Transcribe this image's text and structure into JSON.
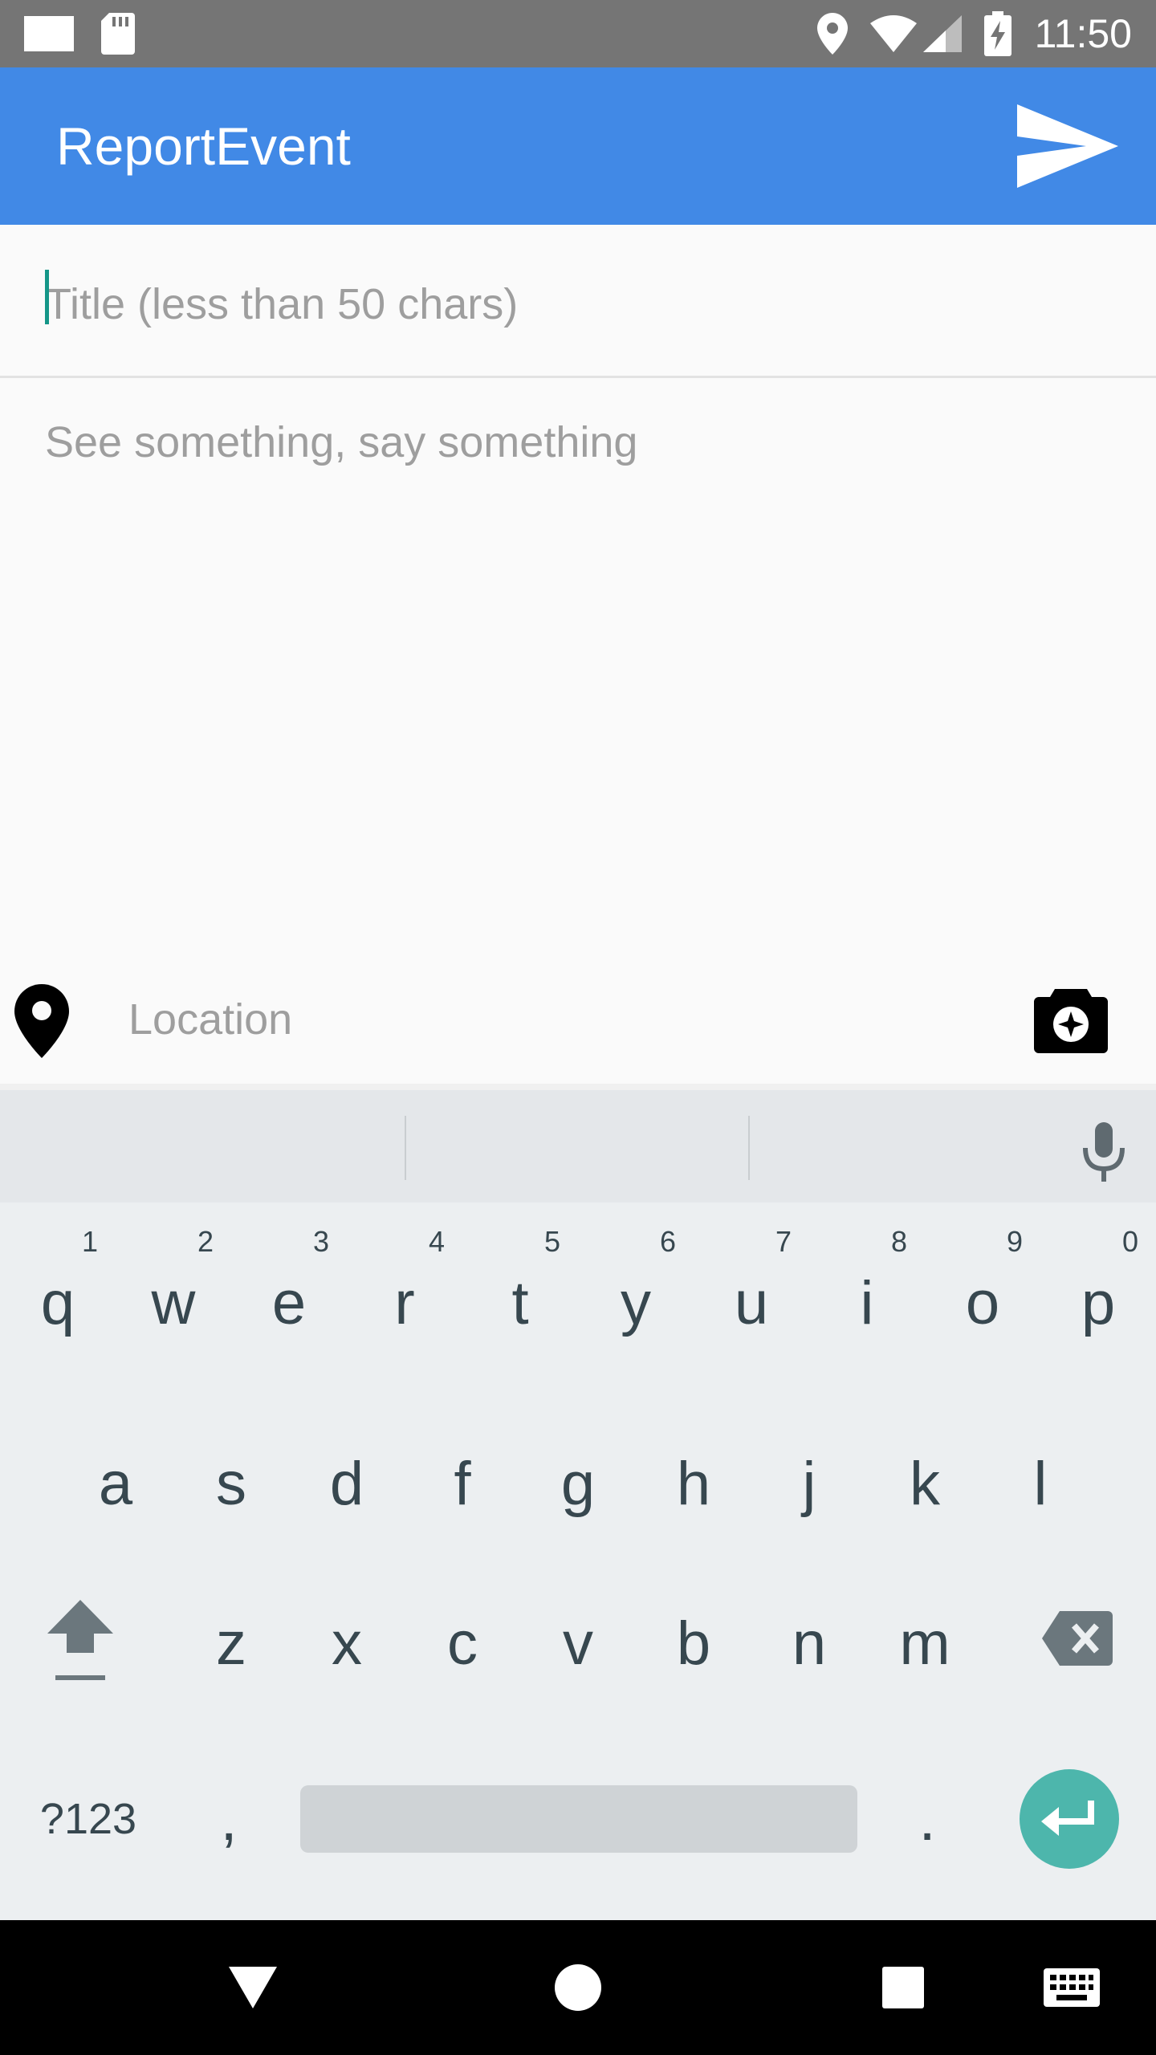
{
  "status_bar": {
    "time": "11:50",
    "icons": [
      "email-icon",
      "sd-card-icon",
      "location-icon",
      "wifi-icon",
      "cell-signal-icon",
      "battery-charging-icon"
    ]
  },
  "app_bar": {
    "title": "ReportEvent",
    "action_icon": "send-icon",
    "color": "#4189e6"
  },
  "form": {
    "title_placeholder": "Title (less than 50 chars)",
    "title_value": "",
    "body_placeholder": "See something, say something",
    "body_value": "",
    "location_placeholder": "Location",
    "location_value": "",
    "location_icon": "map-pin-icon",
    "camera_icon": "camera-icon",
    "caret_color": "#149688"
  },
  "keyboard": {
    "row1": [
      "q",
      "w",
      "e",
      "r",
      "t",
      "y",
      "u",
      "i",
      "o",
      "p"
    ],
    "row1_hints": [
      "1",
      "2",
      "3",
      "4",
      "5",
      "6",
      "7",
      "8",
      "9",
      "0"
    ],
    "row2": [
      "a",
      "s",
      "d",
      "f",
      "g",
      "h",
      "j",
      "k",
      "l"
    ],
    "row3": [
      "z",
      "x",
      "c",
      "v",
      "b",
      "n",
      "m"
    ],
    "symbols_label": "?123",
    "comma_label": ",",
    "period_label": ".",
    "shift_icon": "shift-icon",
    "backspace_icon": "backspace-icon",
    "enter_icon": "enter-icon",
    "mic_icon": "microphone-icon",
    "enter_color": "#4db6ac"
  },
  "nav_bar": {
    "icons": [
      "back-icon",
      "home-icon",
      "recents-icon",
      "keyboard-switch-icon"
    ]
  }
}
